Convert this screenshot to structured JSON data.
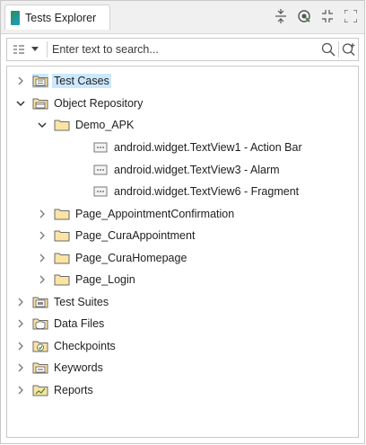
{
  "tab": {
    "title": "Tests Explorer"
  },
  "toolbar_icons": [
    "collapse-all-icon",
    "link-with-editor-icon",
    "minimize-icon",
    "maximize-icon"
  ],
  "search": {
    "placeholder": "Enter text to search..."
  },
  "tree": {
    "items": [
      {
        "label": "Test Cases",
        "icon": "test-cases-folder-icon",
        "expanded": false,
        "selected": true
      },
      {
        "label": "Object Repository",
        "icon": "object-repository-folder-icon",
        "expanded": true
      },
      {
        "label": "Demo_APK",
        "icon": "folder-icon",
        "expanded": true
      },
      {
        "label": "android.widget.TextView1 - Action Bar",
        "icon": "test-object-icon"
      },
      {
        "label": "android.widget.TextView3 - Alarm",
        "icon": "test-object-icon"
      },
      {
        "label": "android.widget.TextView6 - Fragment",
        "icon": "test-object-icon"
      },
      {
        "label": "Page_AppointmentConfirmation",
        "icon": "folder-icon",
        "expanded": false
      },
      {
        "label": "Page_CuraAppointment",
        "icon": "folder-icon",
        "expanded": false
      },
      {
        "label": "Page_CuraHomepage",
        "icon": "folder-icon",
        "expanded": false
      },
      {
        "label": "Page_Login",
        "icon": "folder-icon",
        "expanded": false
      },
      {
        "label": "Test Suites",
        "icon": "test-suites-folder-icon",
        "expanded": false
      },
      {
        "label": "Data Files",
        "icon": "data-files-folder-icon",
        "expanded": false
      },
      {
        "label": "Checkpoints",
        "icon": "checkpoints-folder-icon",
        "expanded": false
      },
      {
        "label": "Keywords",
        "icon": "keywords-folder-icon",
        "expanded": false
      },
      {
        "label": "Reports",
        "icon": "reports-folder-icon",
        "expanded": false
      }
    ]
  },
  "colors": {
    "selection": "#cce8ff",
    "folder": "#f5d78e",
    "accent": "#1aa0c8"
  }
}
